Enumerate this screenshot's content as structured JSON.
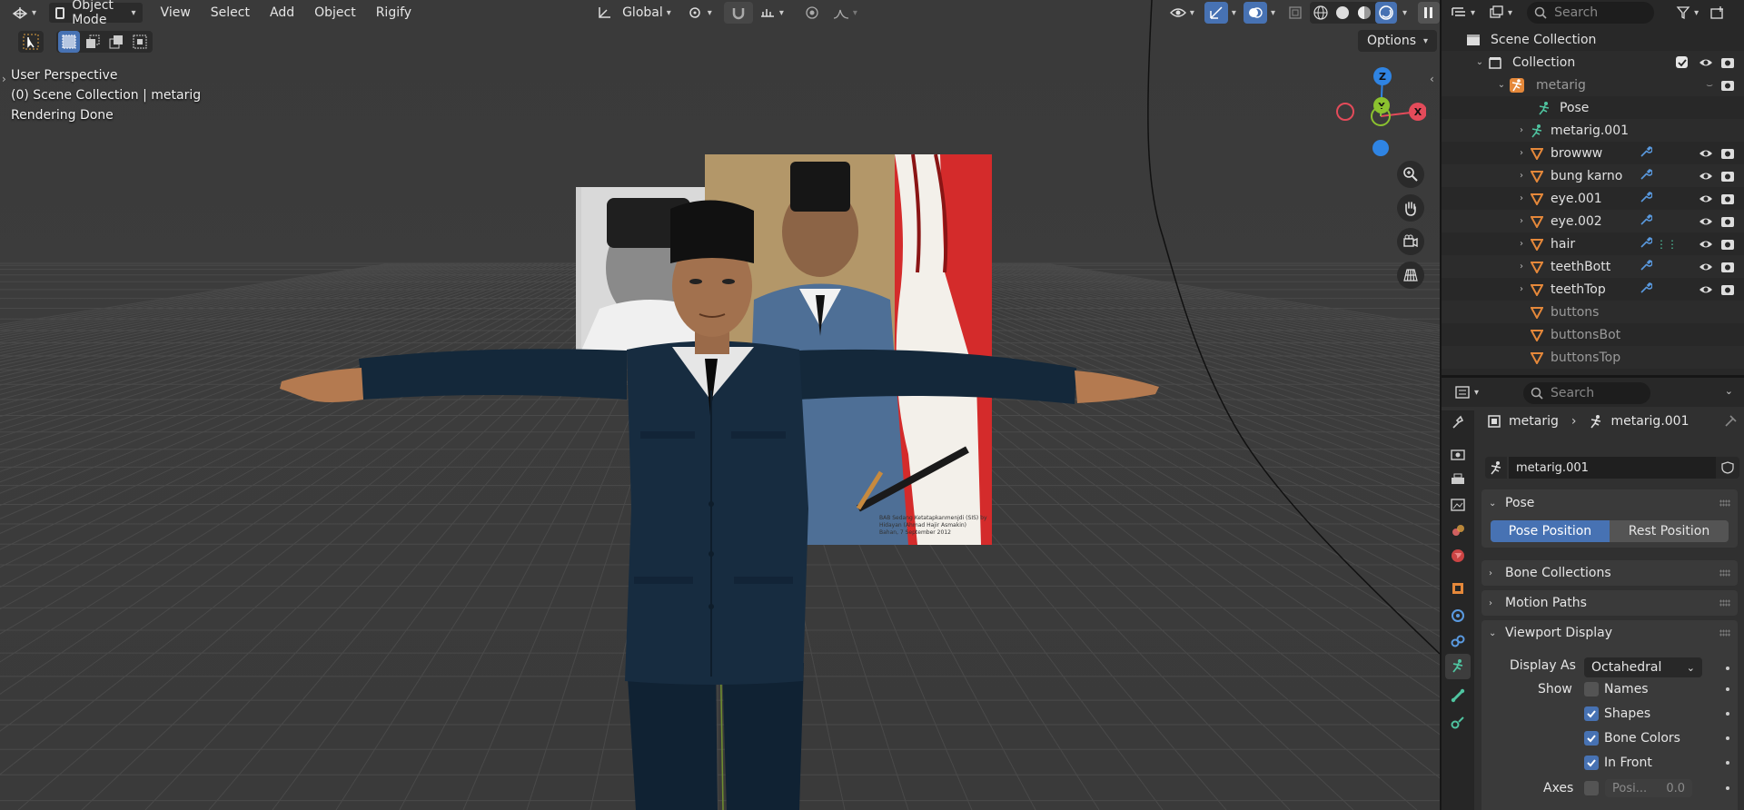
{
  "header": {
    "mode_label": "Object Mode",
    "menus": [
      "View",
      "Select",
      "Add",
      "Object",
      "Rigify"
    ],
    "transform_orientation": "Global",
    "options_label": "Options"
  },
  "viewport_info": {
    "line1": "User Perspective",
    "line2": "(0) Scene Collection | metarig",
    "line3": "Rendering Done"
  },
  "gizmo": {
    "z": "Z",
    "y": "Y",
    "x": "X"
  },
  "outliner": {
    "search_placeholder": "Search",
    "scene_collection": "Scene Collection",
    "collection": "Collection",
    "items": [
      {
        "name": "metarig",
        "type": "armature-object"
      },
      {
        "name": "Pose",
        "type": "pose"
      },
      {
        "name": "metarig.001",
        "type": "armature"
      },
      {
        "name": "browww",
        "type": "mesh"
      },
      {
        "name": "bung karno",
        "type": "mesh"
      },
      {
        "name": "eye.001",
        "type": "mesh"
      },
      {
        "name": "eye.002",
        "type": "mesh"
      },
      {
        "name": "hair",
        "type": "mesh"
      },
      {
        "name": "teethBott",
        "type": "mesh"
      },
      {
        "name": "teethTop",
        "type": "mesh"
      },
      {
        "name": "buttons",
        "type": "mesh"
      },
      {
        "name": "buttonsBot",
        "type": "mesh"
      },
      {
        "name": "buttonsTop",
        "type": "mesh"
      }
    ]
  },
  "properties": {
    "search_placeholder": "Search",
    "breadcrumb_object": "metarig",
    "breadcrumb_data": "metarig.001",
    "armature_name": "metarig.001",
    "pose_panel": "Pose",
    "pose_position": "Pose Position",
    "rest_position": "Rest Position",
    "bone_collections": "Bone Collections",
    "motion_paths": "Motion Paths",
    "viewport_display": "Viewport Display",
    "display_as_label": "Display As",
    "display_as_value": "Octahedral",
    "show_label": "Show",
    "names": "Names",
    "shapes": "Shapes",
    "bone_colors": "Bone Colors",
    "in_front": "In Front",
    "axes_label": "Axes",
    "axes_position_label": "Posi...",
    "axes_value": "0.0"
  },
  "photo_caption": "BAB Sedang Ketatapkanmenjdi (SIS) by Hidayan (Ahmad Hajir Asmakin) Bahan, 7 September 2012",
  "colors": {
    "accent": "#4772b3",
    "panel_bg": "#303030",
    "viewport_bg": "#3c3c3c",
    "axis_x": "#e44b5a",
    "axis_y": "#8bc22f",
    "axis_z": "#2f84e3",
    "mesh_icon": "#e5883a",
    "armature_icon": "#4fc4a0"
  }
}
